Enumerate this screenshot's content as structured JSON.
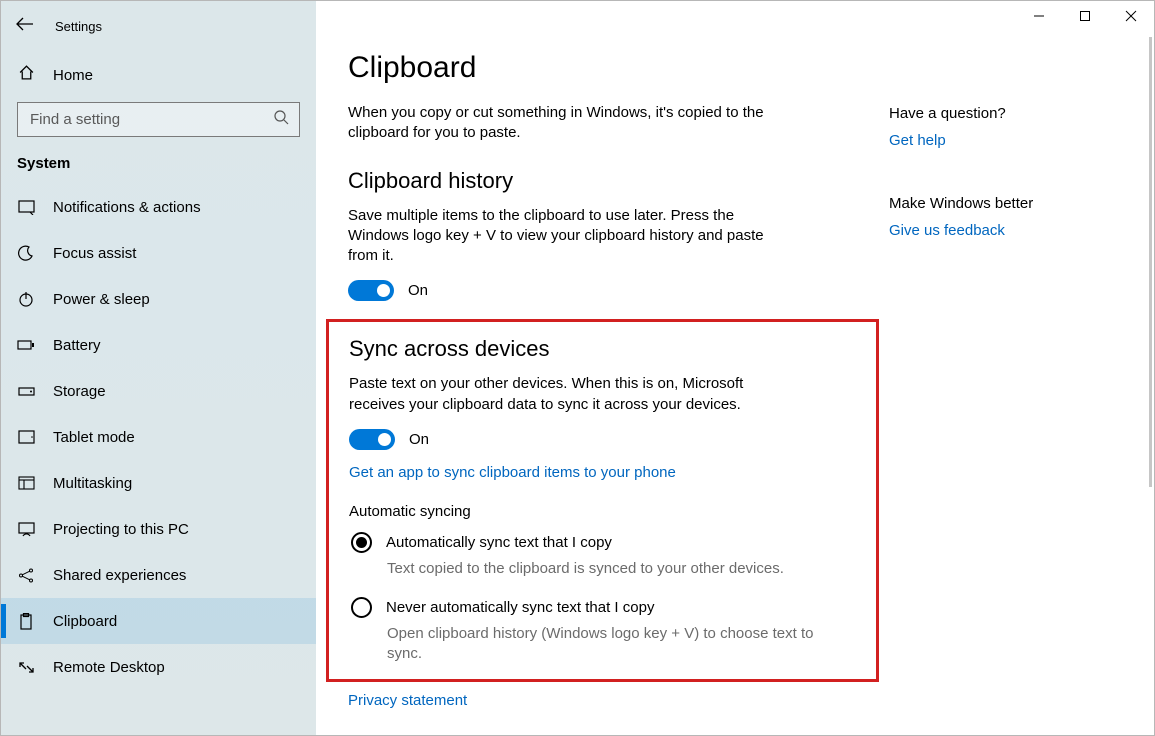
{
  "header": {
    "back_icon": "←",
    "title": "Settings"
  },
  "home": {
    "label": "Home"
  },
  "search": {
    "placeholder": "Find a setting"
  },
  "category": "System",
  "nav": [
    {
      "key": "notifications",
      "label": "Notifications & actions"
    },
    {
      "key": "focus",
      "label": "Focus assist"
    },
    {
      "key": "power",
      "label": "Power & sleep"
    },
    {
      "key": "battery",
      "label": "Battery"
    },
    {
      "key": "storage",
      "label": "Storage"
    },
    {
      "key": "tablet",
      "label": "Tablet mode"
    },
    {
      "key": "multitask",
      "label": "Multitasking"
    },
    {
      "key": "projecting",
      "label": "Projecting to this PC"
    },
    {
      "key": "shared",
      "label": "Shared experiences"
    },
    {
      "key": "clipboard",
      "label": "Clipboard",
      "selected": true
    },
    {
      "key": "remote",
      "label": "Remote Desktop"
    }
  ],
  "page": {
    "title": "Clipboard",
    "intro": "When you copy or cut something in Windows, it's copied to the clipboard for you to paste.",
    "history": {
      "heading": "Clipboard history",
      "body": "Save multiple items to the clipboard to use later. Press the Windows logo key + V to view your clipboard history and paste from it.",
      "state": "On"
    },
    "sync": {
      "heading": "Sync across devices",
      "body": "Paste text on your other devices. When this is on, Microsoft receives your clipboard data to sync it across your devices.",
      "state": "On",
      "app_link": "Get an app to sync clipboard items to your phone",
      "auto_label": "Automatic syncing",
      "opt1": {
        "label": "Automatically sync text that I copy",
        "desc": "Text copied to the clipboard is synced to your other devices."
      },
      "opt2": {
        "label": "Never automatically sync text that I copy",
        "desc": "Open clipboard history (Windows logo key + V) to choose text to sync."
      }
    },
    "privacy_link": "Privacy statement"
  },
  "aside": {
    "q1_title": "Have a question?",
    "q1_link": "Get help",
    "q2_title": "Make Windows better",
    "q2_link": "Give us feedback"
  }
}
